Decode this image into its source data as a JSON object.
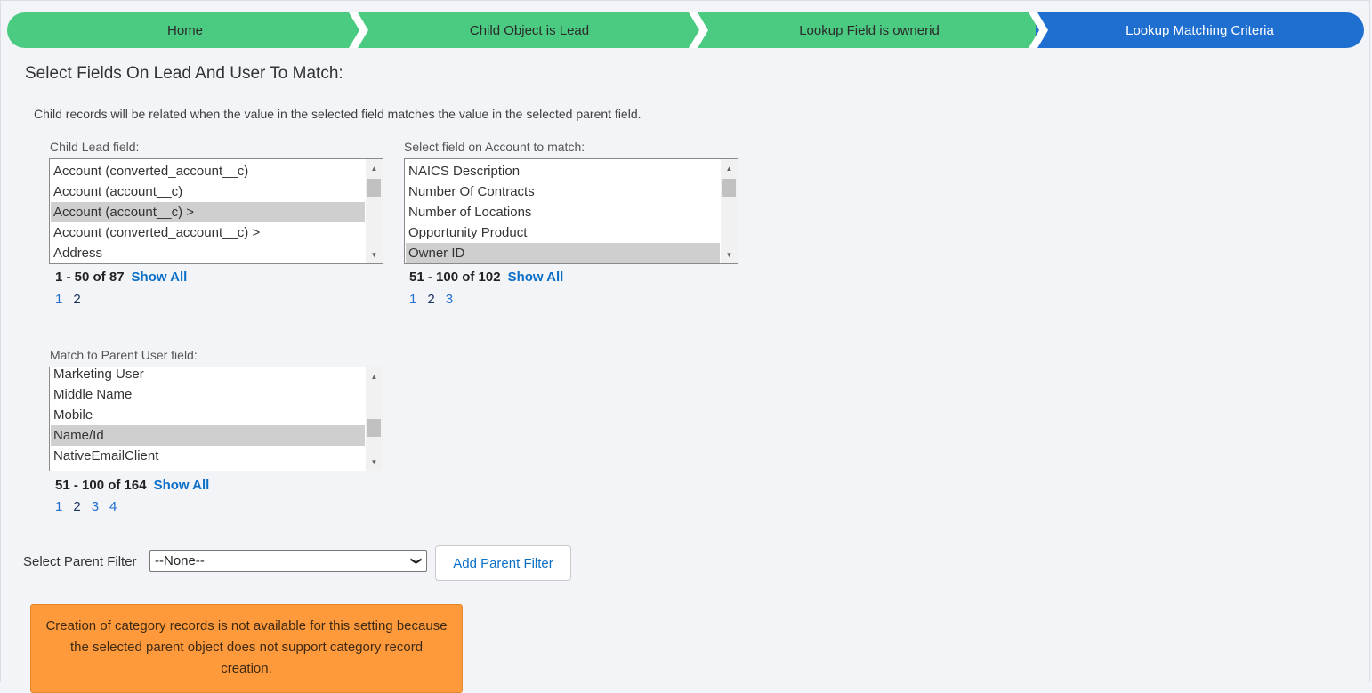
{
  "path": {
    "steps": [
      {
        "label": "Home"
      },
      {
        "label": "Child Object is Lead"
      },
      {
        "label": "Lookup Field is ownerid"
      },
      {
        "label": "Lookup Matching Criteria"
      }
    ],
    "colors": {
      "complete": "#4bca81",
      "current": "#1f6fd0"
    }
  },
  "section_title": "Select Fields On Lead And User To Match:",
  "description": "Child records will be related when the value in the selected field matches the value in the selected parent field.",
  "child_field": {
    "label": "Child Lead field:",
    "options": [
      "Account (converted_account__c)",
      "Account (account__c)",
      "Account (account__c) >",
      "Account (converted_account__c) >",
      "Address"
    ],
    "selected_index": 2,
    "range": "1 - 50 of 87",
    "show_all": "Show All",
    "pages": [
      "1",
      "2"
    ]
  },
  "account_field": {
    "label": "Select field on Account to match:",
    "options": [
      "NAICS Description",
      "Number Of Contracts",
      "Number of Locations",
      "Opportunity Product",
      "Owner ID"
    ],
    "selected_index": 4,
    "range": "51 - 100 of 102",
    "show_all": "Show All",
    "pages": [
      "1",
      "2",
      "3"
    ]
  },
  "parent_field": {
    "label": "Match to Parent User field:",
    "options": [
      "Marketing User",
      "Middle Name",
      "Mobile",
      "Name/Id",
      "NativeEmailClient"
    ],
    "selected_index": 3,
    "range": "51 - 100 of 164",
    "show_all": "Show All",
    "pages": [
      "1",
      "2",
      "3",
      "4"
    ]
  },
  "filter": {
    "label": "Select Parent Filter",
    "value": "--None--",
    "button": "Add Parent Filter"
  },
  "warning": "Creation of category records is not available for this setting because the selected parent object does not support category record creation."
}
